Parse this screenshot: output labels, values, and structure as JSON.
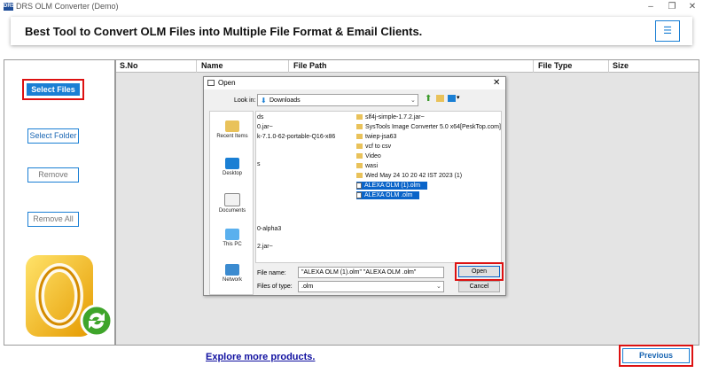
{
  "window": {
    "logo_text": "DRS",
    "title": "DRS OLM Converter (Demo)"
  },
  "banner": {
    "title": "Best Tool to Convert OLM Files into Multiple File Format & Email Clients.",
    "menu_icon": "hamburger-icon"
  },
  "sidebar": {
    "select_files": "Select Files",
    "select_folder": "Select Folder",
    "remove": "Remove",
    "remove_all": "Remove All"
  },
  "table": {
    "columns": [
      "S.No",
      "Name",
      "File Path",
      "File Type",
      "Size"
    ]
  },
  "dialog": {
    "title": "Open",
    "look_in_label": "Look in:",
    "look_in_value": "Downloads",
    "places": [
      "Recent Items",
      "Desktop",
      "Documents",
      "This PC",
      "Network"
    ],
    "left_column_items": [
      "ds",
      "0.jar~",
      "k-7.1.0-62-portable-Q16-x86",
      "s",
      "0-alpha3",
      "2.jar~"
    ],
    "right_column_items": [
      {
        "name": "slf4j-simple-1.7.2.jar~",
        "type": "folder",
        "selected": false
      },
      {
        "name": "SysTools Image Converter 5.0 x64[PeskTop.com]",
        "type": "folder",
        "selected": false
      },
      {
        "name": "twiep-jsa63",
        "type": "folder",
        "selected": false
      },
      {
        "name": "vcf to csv",
        "type": "folder",
        "selected": false
      },
      {
        "name": "Video",
        "type": "folder",
        "selected": false
      },
      {
        "name": "wasi",
        "type": "folder",
        "selected": false
      },
      {
        "name": "Wed May 24 10 20 42 IST 2023 (1)",
        "type": "folder",
        "selected": false
      },
      {
        "name": "ALEXA OLM  (1).olm",
        "type": "file",
        "selected": true
      },
      {
        "name": "ALEXA OLM .olm",
        "type": "file",
        "selected": true
      }
    ],
    "file_name_label": "File name:",
    "file_name_value": "\"ALEXA OLM  (1).olm\" \"ALEXA OLM .olm\"",
    "file_type_label": "Files of type:",
    "file_type_value": ".olm",
    "open": "Open",
    "cancel": "Cancel"
  },
  "footer": {
    "explore": "Explore more products.",
    "previous": "Previous"
  },
  "colors": {
    "accent": "#1a7fd4",
    "highlight": "#dd1111",
    "selection": "#0a64c9"
  }
}
